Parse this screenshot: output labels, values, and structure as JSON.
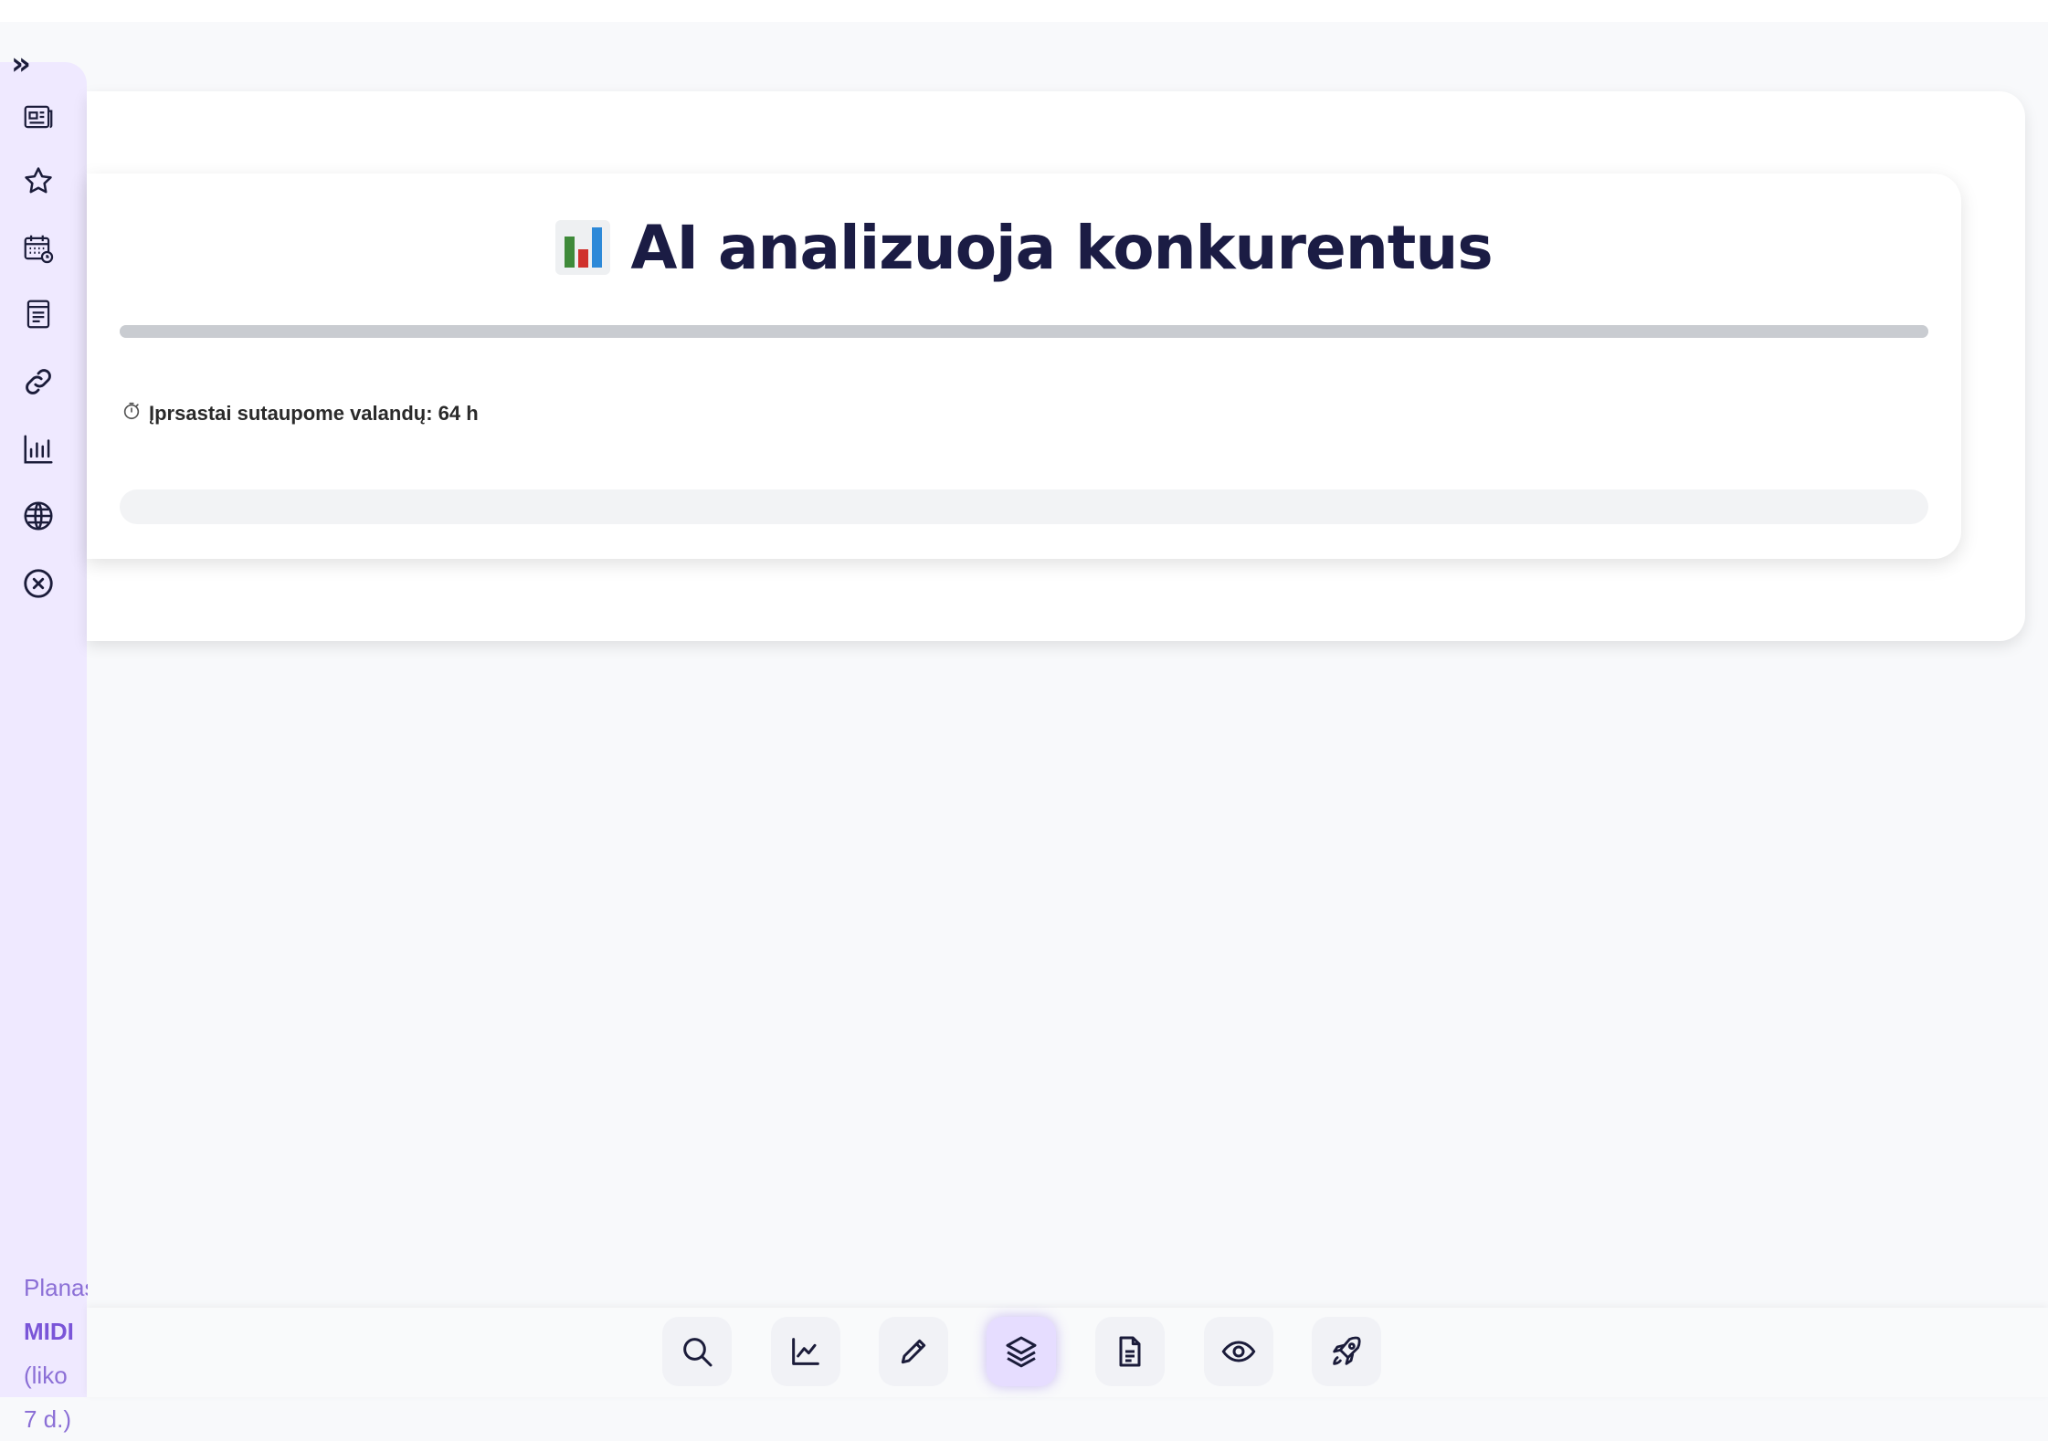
{
  "app": {
    "expand_label": "»"
  },
  "sidebar": {
    "items": [
      {
        "name": "news",
        "icon": "newspaper-icon"
      },
      {
        "name": "favorites",
        "icon": "star-icon"
      },
      {
        "name": "calendar",
        "icon": "calendar-clock-icon"
      },
      {
        "name": "notes",
        "icon": "notepad-icon"
      },
      {
        "name": "links",
        "icon": "link-icon"
      },
      {
        "name": "statistics",
        "icon": "bar-chart-icon"
      },
      {
        "name": "web",
        "icon": "globe-icon"
      },
      {
        "name": "close",
        "icon": "close-circle-icon"
      }
    ],
    "plan": {
      "label": "Planas",
      "name": "MIDI",
      "remaining_open": "(liko",
      "remaining_days": "7 d.)"
    }
  },
  "card": {
    "emoji_icon": "bar-chart-emoji-icon",
    "title": "AI analizuoja konkurentus",
    "progress": 1.0,
    "saved_hours_label": "Įprsastai sutaupome valandų: 64 h",
    "saved_icon": "stopwatch-icon"
  },
  "bottom_toolbar": {
    "buttons": [
      {
        "name": "search",
        "icon": "search-icon",
        "active": false
      },
      {
        "name": "analytics",
        "icon": "line-chart-icon",
        "active": false
      },
      {
        "name": "edit",
        "icon": "pencil-icon",
        "active": false
      },
      {
        "name": "layers",
        "icon": "layers-icon",
        "active": true
      },
      {
        "name": "document",
        "icon": "document-icon",
        "active": false
      },
      {
        "name": "preview",
        "icon": "eye-icon",
        "active": false
      },
      {
        "name": "launch",
        "icon": "rocket-icon",
        "active": false
      }
    ]
  },
  "colors": {
    "sidebar_bg": "#efe9ff",
    "accent": "#7a55d8",
    "title": "#1b1c44",
    "active_button": "#e6ddff"
  }
}
